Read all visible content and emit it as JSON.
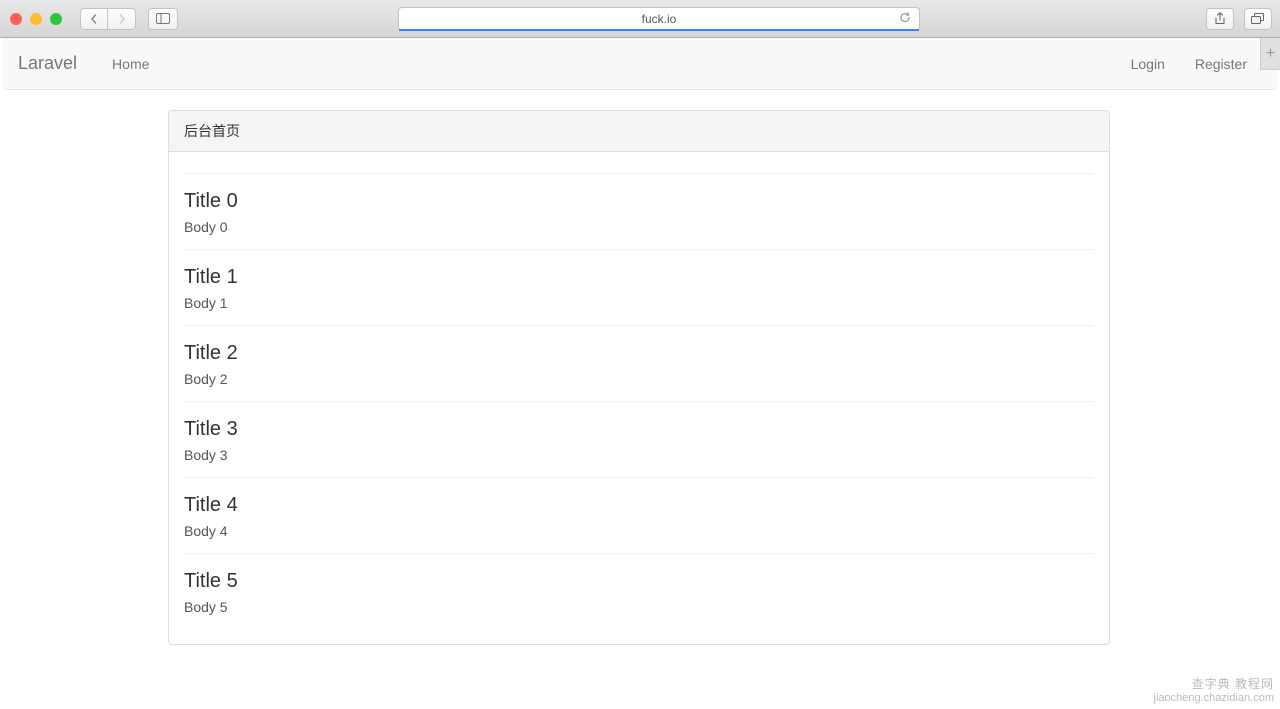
{
  "browser": {
    "url": "fuck.io"
  },
  "navbar": {
    "brand": "Laravel",
    "home": "Home",
    "login": "Login",
    "register": "Register"
  },
  "panel": {
    "heading": "后台首页"
  },
  "posts": [
    {
      "title": "Title 0",
      "body": "Body 0"
    },
    {
      "title": "Title 1",
      "body": "Body 1"
    },
    {
      "title": "Title 2",
      "body": "Body 2"
    },
    {
      "title": "Title 3",
      "body": "Body 3"
    },
    {
      "title": "Title 4",
      "body": "Body 4"
    },
    {
      "title": "Title 5",
      "body": "Body 5"
    }
  ],
  "watermark": {
    "line1": "查字典  教程网",
    "line2": "jiaocheng.chazidian.com"
  }
}
